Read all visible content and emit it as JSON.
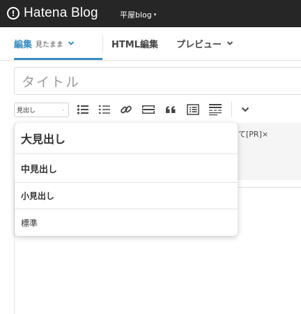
{
  "header": {
    "app_title": "Hatena Blog",
    "blog_name": "平屋blog",
    "blog_caret": "▾",
    "logo_glyph": "!"
  },
  "tabs": {
    "edit_label": "編集",
    "edit_mode": "見たまま",
    "html_label": "HTML編集",
    "preview_label": "プレビュー"
  },
  "editor": {
    "title_placeholder": "タイトル",
    "format_selected": "見出し",
    "format_caret": "▸"
  },
  "toolbar_icons": [
    "bullet-list-icon",
    "numbered-list-icon",
    "link-icon",
    "horizontal-rule-icon",
    "blockquote-icon",
    "table-of-contents-icon",
    "more-toggle-icon",
    "chevron-down-icon"
  ],
  "content": {
    "ad_text": "て[PR]×"
  },
  "format_menu": {
    "items": [
      "大見出し",
      "中見出し",
      "小見出し",
      "標準"
    ]
  },
  "colors": {
    "header_bg": "#262626",
    "accent": "#3a8cc1"
  }
}
